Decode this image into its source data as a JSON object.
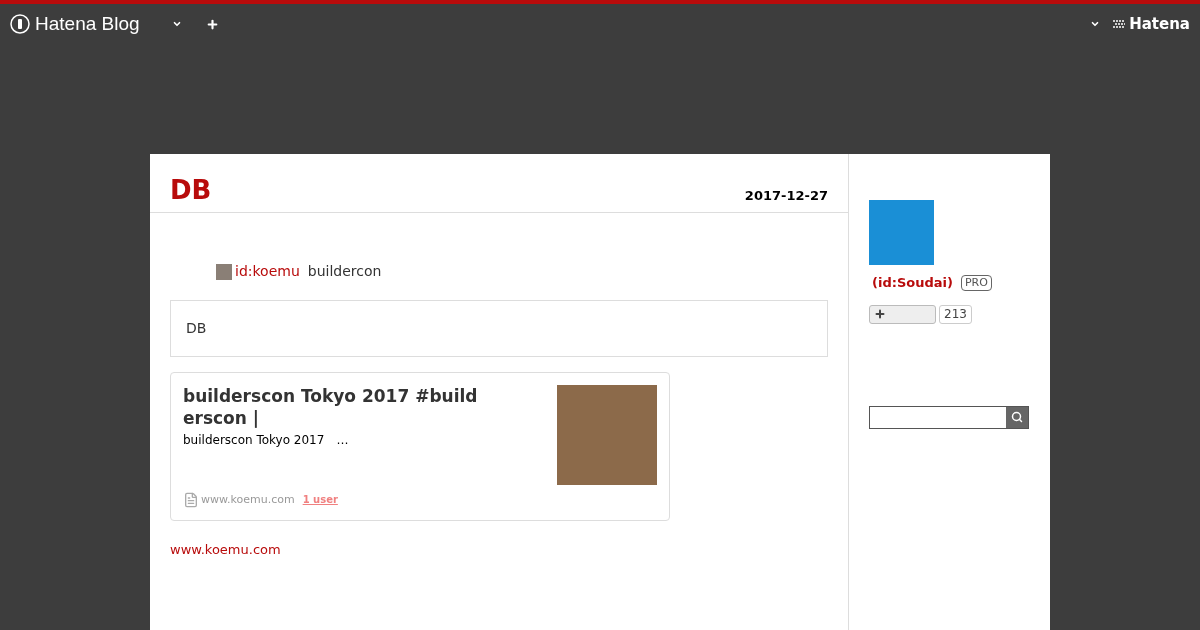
{
  "navbar": {
    "logo": "Hatena Blog",
    "right_logo": "Hatena"
  },
  "entry": {
    "title": "DB",
    "date": "2017-12-27",
    "author": "id:koemu",
    "author_text": "buildercon",
    "quote": "DB",
    "embed": {
      "title": "builderscon Tokyo 2017 #builderscon |",
      "description": "builderscon Tokyo 2017　…",
      "site": "www.koemu.com",
      "users": "1 user"
    },
    "link": "www.koemu.com"
  },
  "sidebar": {
    "user": "(id:Soudai)",
    "badge": "PRO",
    "star_count": "213"
  }
}
